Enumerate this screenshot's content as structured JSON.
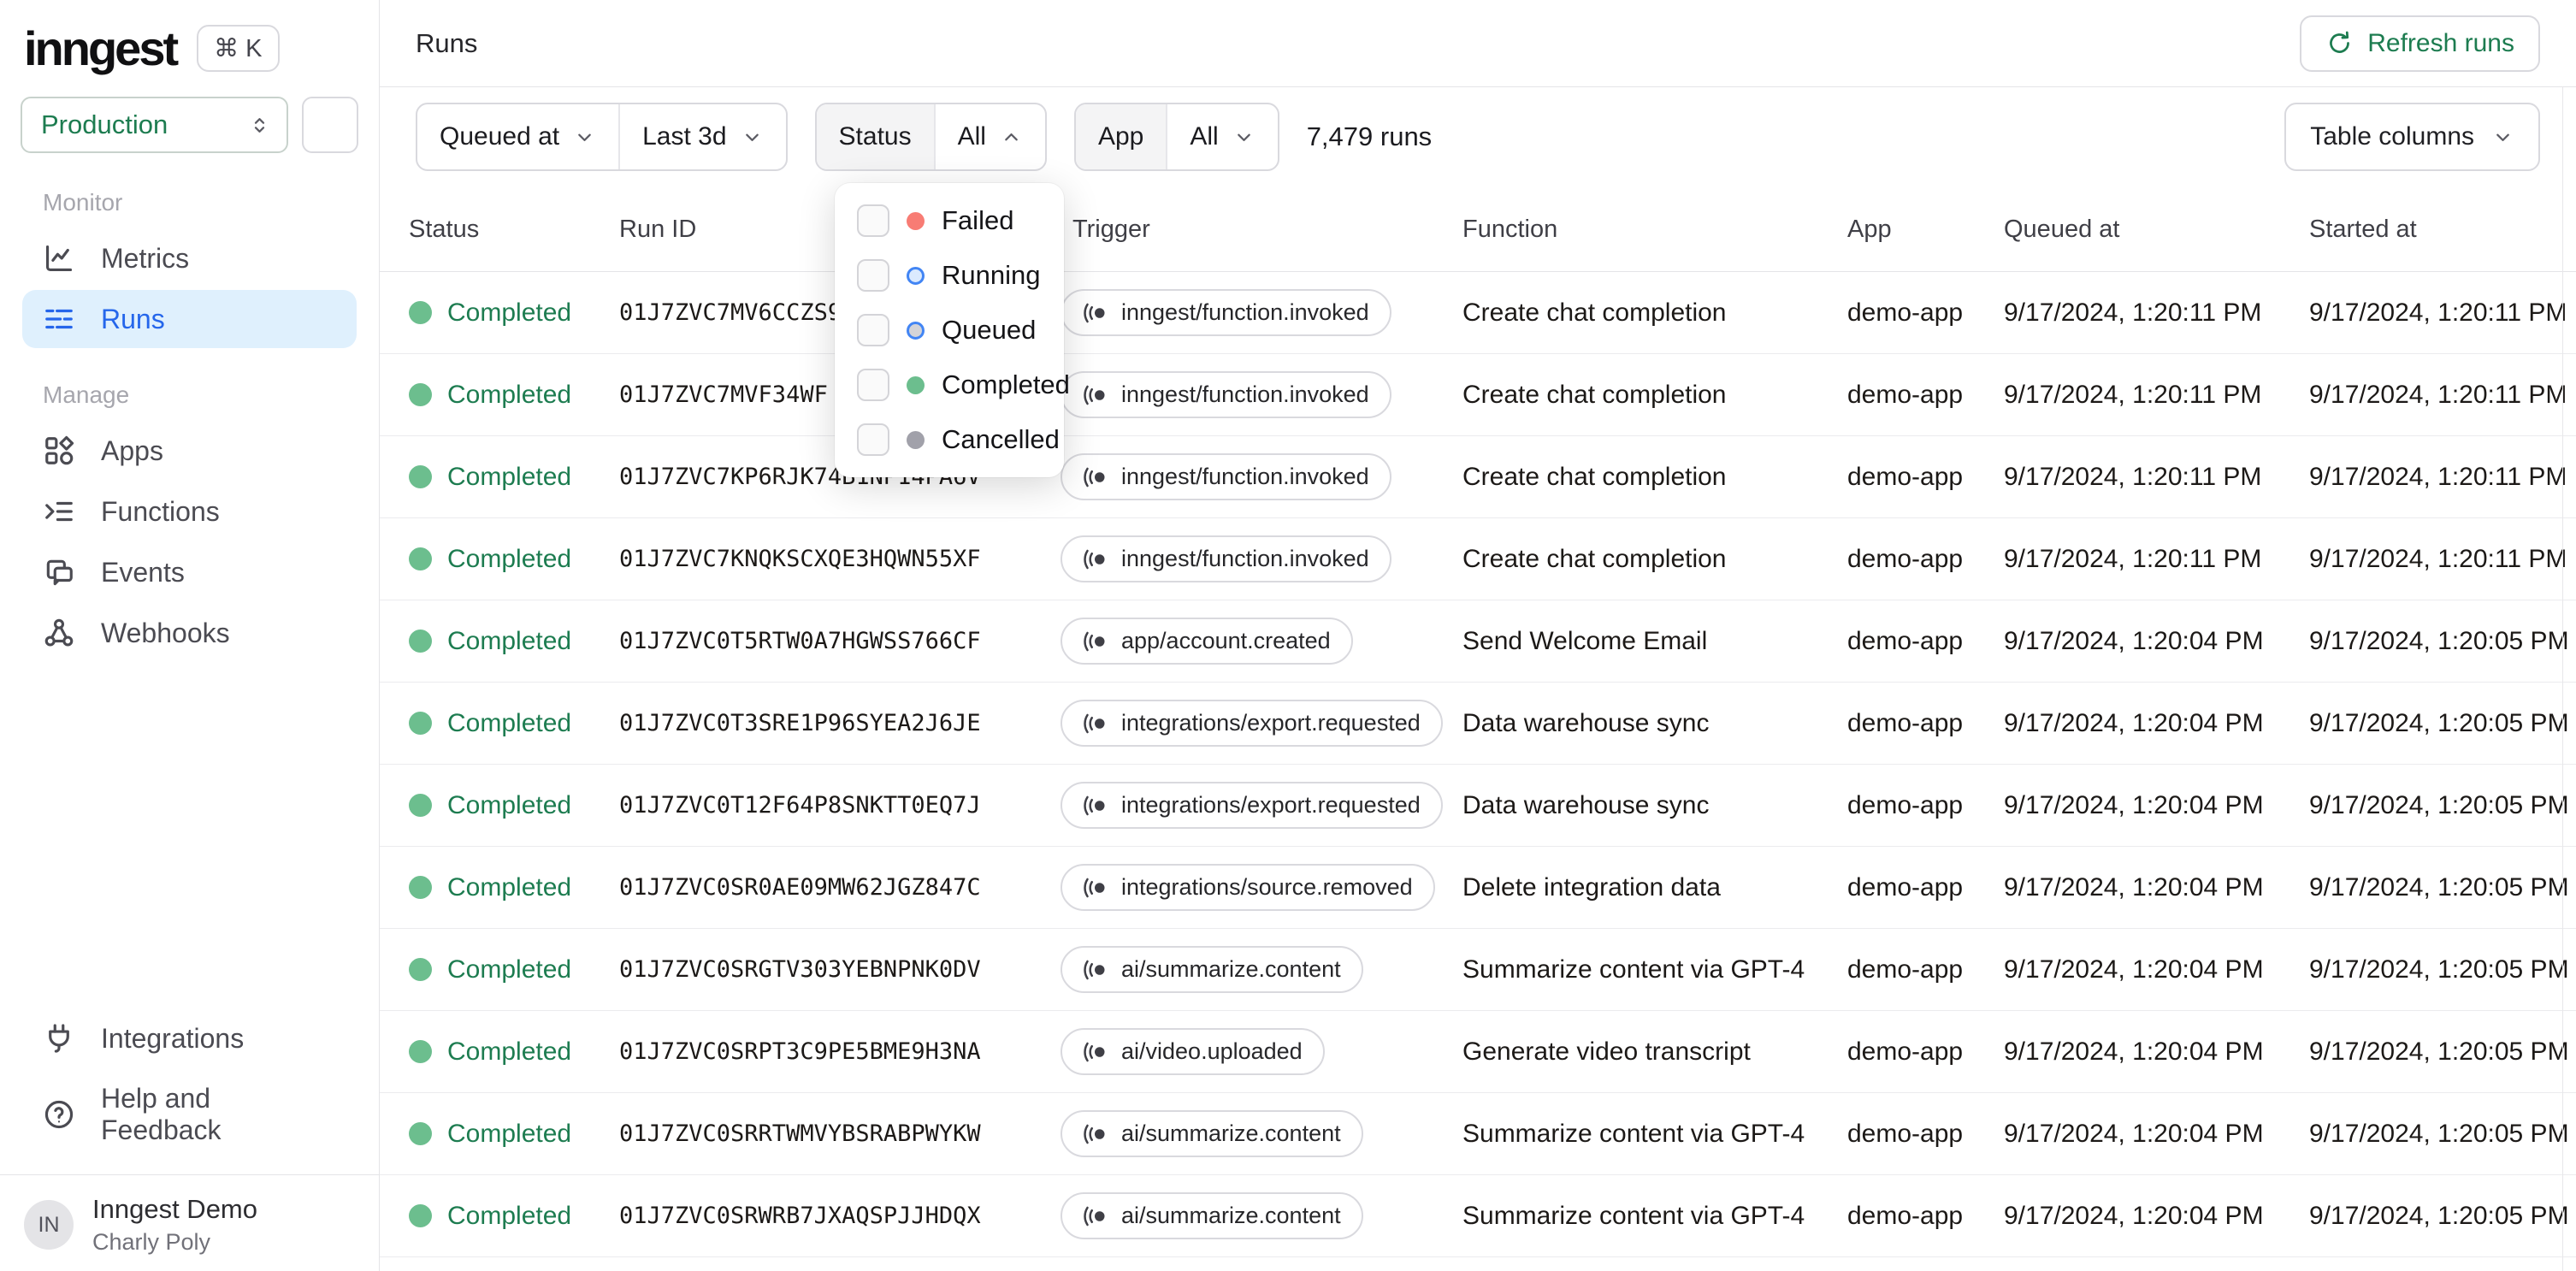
{
  "sidebar": {
    "logo_text": "inngest",
    "shortcut": "⌘ K",
    "environment": "Production",
    "sections": [
      {
        "label": "Monitor",
        "items": [
          {
            "label": "Metrics",
            "icon": "metrics-icon",
            "active": false
          },
          {
            "label": "Runs",
            "icon": "runs-icon",
            "active": true
          }
        ]
      },
      {
        "label": "Manage",
        "items": [
          {
            "label": "Apps",
            "icon": "apps-icon",
            "active": false
          },
          {
            "label": "Functions",
            "icon": "functions-icon",
            "active": false
          },
          {
            "label": "Events",
            "icon": "events-icon",
            "active": false
          },
          {
            "label": "Webhooks",
            "icon": "webhooks-icon",
            "active": false
          }
        ]
      }
    ],
    "footer_items": [
      {
        "label": "Integrations",
        "icon": "integrations-icon"
      },
      {
        "label": "Help and Feedback",
        "icon": "help-icon"
      }
    ],
    "user": {
      "initials": "IN",
      "org": "Inngest Demo",
      "name": "Charly Poly"
    }
  },
  "header": {
    "title": "Runs",
    "refresh_label": "Refresh runs"
  },
  "filters": {
    "queued_at_label": "Queued at",
    "time_range_value": "Last 3d",
    "status_label": "Status",
    "status_value": "All",
    "app_label": "App",
    "app_value": "All",
    "runs_count": "7,479 runs",
    "table_columns_label": "Table columns"
  },
  "status_dropdown": {
    "options": [
      {
        "label": "Failed",
        "style": "filled",
        "color": "#f87c74",
        "fill": ""
      },
      {
        "label": "Running",
        "style": "ring",
        "color": "#4285f4",
        "fill": "#dbeafe"
      },
      {
        "label": "Queued",
        "style": "ring",
        "color": "#4285f4",
        "fill": "#d4d4d8"
      },
      {
        "label": "Completed",
        "style": "filled",
        "color": "#6cbe8e",
        "fill": ""
      },
      {
        "label": "Cancelled",
        "style": "filled",
        "color": "#a1a1aa",
        "fill": ""
      }
    ]
  },
  "table": {
    "columns": [
      "Status",
      "Run ID",
      "Trigger",
      "Function",
      "App",
      "Queued at",
      "Started at"
    ],
    "rows": [
      {
        "status": "Completed",
        "run_id": "01J7ZVC7MV6CCZS9",
        "trigger": "inngest/function.invoked",
        "function": "Create chat completion",
        "app": "demo-app",
        "queued_at": "9/17/2024, 1:20:11 PM",
        "started_at": "9/17/2024, 1:20:11 PM"
      },
      {
        "status": "Completed",
        "run_id": "01J7ZVC7MVF34WF",
        "trigger": "inngest/function.invoked",
        "function": "Create chat completion",
        "app": "demo-app",
        "queued_at": "9/17/2024, 1:20:11 PM",
        "started_at": "9/17/2024, 1:20:11 PM"
      },
      {
        "status": "Completed",
        "run_id": "01J7ZVC7KP6RJK74B1NP14PA6V",
        "trigger": "inngest/function.invoked",
        "function": "Create chat completion",
        "app": "demo-app",
        "queued_at": "9/17/2024, 1:20:11 PM",
        "started_at": "9/17/2024, 1:20:11 PM"
      },
      {
        "status": "Completed",
        "run_id": "01J7ZVC7KNQKSCXQE3HQWN55XF",
        "trigger": "inngest/function.invoked",
        "function": "Create chat completion",
        "app": "demo-app",
        "queued_at": "9/17/2024, 1:20:11 PM",
        "started_at": "9/17/2024, 1:20:11 PM"
      },
      {
        "status": "Completed",
        "run_id": "01J7ZVC0T5RTW0A7HGWSS766CF",
        "trigger": "app/account.created",
        "function": "Send Welcome Email",
        "app": "demo-app",
        "queued_at": "9/17/2024, 1:20:04 PM",
        "started_at": "9/17/2024, 1:20:05 PM"
      },
      {
        "status": "Completed",
        "run_id": "01J7ZVC0T3SRE1P96SYEA2J6JE",
        "trigger": "integrations/export.requested",
        "function": "Data warehouse sync",
        "app": "demo-app",
        "queued_at": "9/17/2024, 1:20:04 PM",
        "started_at": "9/17/2024, 1:20:05 PM"
      },
      {
        "status": "Completed",
        "run_id": "01J7ZVC0T12F64P8SNKTT0EQ7J",
        "trigger": "integrations/export.requested",
        "function": "Data warehouse sync",
        "app": "demo-app",
        "queued_at": "9/17/2024, 1:20:04 PM",
        "started_at": "9/17/2024, 1:20:05 PM"
      },
      {
        "status": "Completed",
        "run_id": "01J7ZVC0SR0AE09MW62JGZ847C",
        "trigger": "integrations/source.removed",
        "function": "Delete integration data",
        "app": "demo-app",
        "queued_at": "9/17/2024, 1:20:04 PM",
        "started_at": "9/17/2024, 1:20:05 PM"
      },
      {
        "status": "Completed",
        "run_id": "01J7ZVC0SRGTV303YEBNPNK0DV",
        "trigger": "ai/summarize.content",
        "function": "Summarize content via GPT-4",
        "app": "demo-app",
        "queued_at": "9/17/2024, 1:20:04 PM",
        "started_at": "9/17/2024, 1:20:05 PM"
      },
      {
        "status": "Completed",
        "run_id": "01J7ZVC0SRPT3C9PE5BME9H3NA",
        "trigger": "ai/video.uploaded",
        "function": "Generate video transcript",
        "app": "demo-app",
        "queued_at": "9/17/2024, 1:20:04 PM",
        "started_at": "9/17/2024, 1:20:05 PM"
      },
      {
        "status": "Completed",
        "run_id": "01J7ZVC0SRRTWMVYBSRABPWYKW",
        "trigger": "ai/summarize.content",
        "function": "Summarize content via GPT-4",
        "app": "demo-app",
        "queued_at": "9/17/2024, 1:20:04 PM",
        "started_at": "9/17/2024, 1:20:05 PM"
      },
      {
        "status": "Completed",
        "run_id": "01J7ZVC0SRWRB7JXAQSPJJHDQX",
        "trigger": "ai/summarize.content",
        "function": "Summarize content via GPT-4",
        "app": "demo-app",
        "queued_at": "9/17/2024, 1:20:04 PM",
        "started_at": "9/17/2024, 1:20:05 PM"
      }
    ]
  },
  "colors": {
    "accent_green": "#1d7c50",
    "completed_dot": "#6cbe8e",
    "active_blue": "#2566eb",
    "active_blue_bg": "#dff0fd",
    "failed_dot": "#f87c74",
    "running_ring": "#4285f4",
    "running_fill": "#dbeafe",
    "queued_ring": "#4285f4",
    "queued_fill": "#d4d4d8",
    "cancelled_dot": "#a1a1aa"
  }
}
